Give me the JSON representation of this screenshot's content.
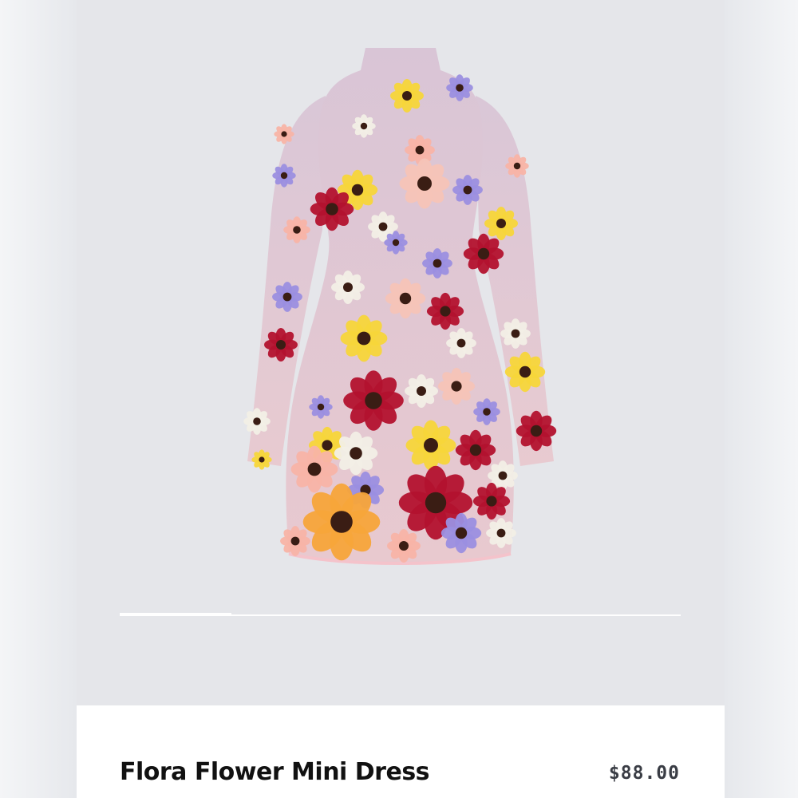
{
  "product": {
    "name": "Flora Flower Mini Dress",
    "price": "$88.00",
    "image_subject": "floral-embroidered-mini-dress"
  },
  "gallery": {
    "slide_index": 1,
    "slide_fraction": 0.2
  },
  "colors": {
    "gallery_bg": "#e5e6ea",
    "card_bg": "#ffffff",
    "name_text": "#111111",
    "price_text": "#3a3d45"
  }
}
